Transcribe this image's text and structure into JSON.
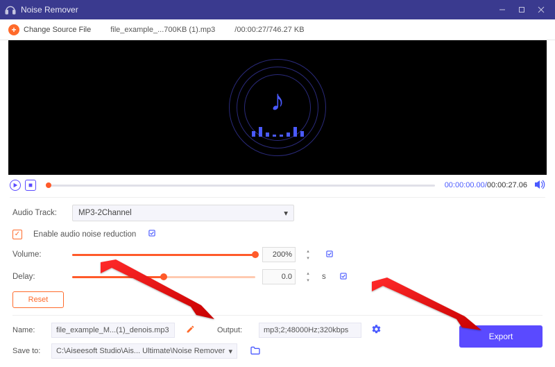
{
  "window": {
    "title": "Noise Remover"
  },
  "toolbar": {
    "change_source": "Change Source File",
    "filename": "file_example_...700KB (1).mp3",
    "fileinfo": "/00:00:27/746.27 KB"
  },
  "playbar": {
    "current": "00:00:00.00",
    "duration": "00:00:27.06"
  },
  "audio_track": {
    "label": "Audio Track:",
    "value": "MP3-2Channel"
  },
  "noise": {
    "label": "Enable audio noise reduction"
  },
  "volume": {
    "label": "Volume:",
    "value": "200%",
    "fill_pct": 100
  },
  "delay": {
    "label": "Delay:",
    "value": "0.0",
    "unit": "s",
    "fill_pct": 50
  },
  "reset": {
    "label": "Reset"
  },
  "name": {
    "label": "Name:",
    "value": "file_example_M...(1)_denois.mp3"
  },
  "output": {
    "label": "Output:",
    "value": "mp3;2;48000Hz;320kbps"
  },
  "saveto": {
    "label": "Save to:",
    "value": "C:\\Aiseesoft Studio\\Ais... Ultimate\\Noise Remover"
  },
  "export": {
    "label": "Export"
  }
}
